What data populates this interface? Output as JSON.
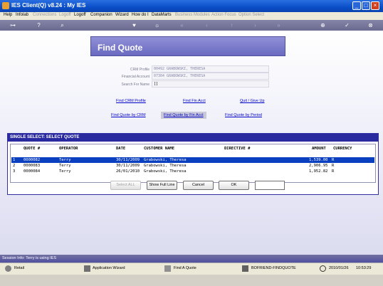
{
  "window": {
    "title": "IES Client(Q) v8.24 : My IES"
  },
  "menu": [
    {
      "label": "Help",
      "enabled": true
    },
    {
      "label": "Infolab",
      "enabled": true
    },
    {
      "label": "Connections",
      "enabled": false
    },
    {
      "label": "Logoff",
      "enabled": false
    },
    {
      "label": "Logoff",
      "enabled": true
    },
    {
      "label": "Companion",
      "enabled": true
    },
    {
      "label": "Wizard",
      "enabled": true
    },
    {
      "label": "How do I",
      "enabled": true
    },
    {
      "label": "DataMarts",
      "enabled": true
    },
    {
      "label": "Business Modules",
      "enabled": false
    },
    {
      "label": "Action Focus",
      "enabled": false
    },
    {
      "label": "Option Select",
      "enabled": false
    }
  ],
  "banner": {
    "title": "Find Quote"
  },
  "fields": {
    "crm_profile": {
      "label": "CRM Profile",
      "value": "00492 GRABOWSKI, THERESA"
    },
    "financial_account": {
      "label": "Financial Account",
      "value": "07304 GRABOWSKI, THERESA"
    },
    "search_for_name": {
      "label": "Search For Name",
      "value": "[]"
    }
  },
  "links": {
    "find_crm_profile": "Find CRM Profile",
    "find_fin_acct": "Find Fin Acct",
    "quit": "Quit / Give Up",
    "find_quote_by_crm": "Find Quote by CRM",
    "find_quote_by_fin_acct": "Find Quote by Fin Acct",
    "find_quote_by_period": "Find Quote by Period"
  },
  "select_panel": {
    "title": "SINGLE SELECT: SELECT QUOTE",
    "columns": [
      "QUOTE #",
      "OPERATOR",
      "DATE",
      "CUSTOMER NAME",
      "DIRECTIVE #",
      "AMOUNT",
      "CURRENCY"
    ],
    "rows": [
      {
        "n": "1",
        "quote": "0000082",
        "operator": "Terry",
        "date": "30/11/2009",
        "customer": "Grabowski, Theresa",
        "amount": "1,539.00",
        "currency": "R"
      },
      {
        "n": "2",
        "quote": "0000083",
        "operator": "Terry",
        "date": "30/11/2009",
        "customer": "Grabowski, Theresa",
        "amount": "2,906.95",
        "currency": "R"
      },
      {
        "n": "3",
        "quote": "0000084",
        "operator": "Terry",
        "date": "26/01/2010",
        "customer": "Grabowski, Theresa",
        "amount": "1,952.82",
        "currency": "R"
      }
    ],
    "buttons": {
      "select_all": "Select ALL",
      "show_full_line": "Show Full Line",
      "cancel": "Cancel",
      "ok": "OK"
    }
  },
  "session_info": "Session Info: Terry is using IES",
  "status": {
    "retail": "Retail",
    "application_wizard": "Application Wizard",
    "find_a_quote": "Find A Quote",
    "form": "BOFRIEND-FINDQUOTE",
    "date": "2010/01/26",
    "time": "10:53:29"
  }
}
